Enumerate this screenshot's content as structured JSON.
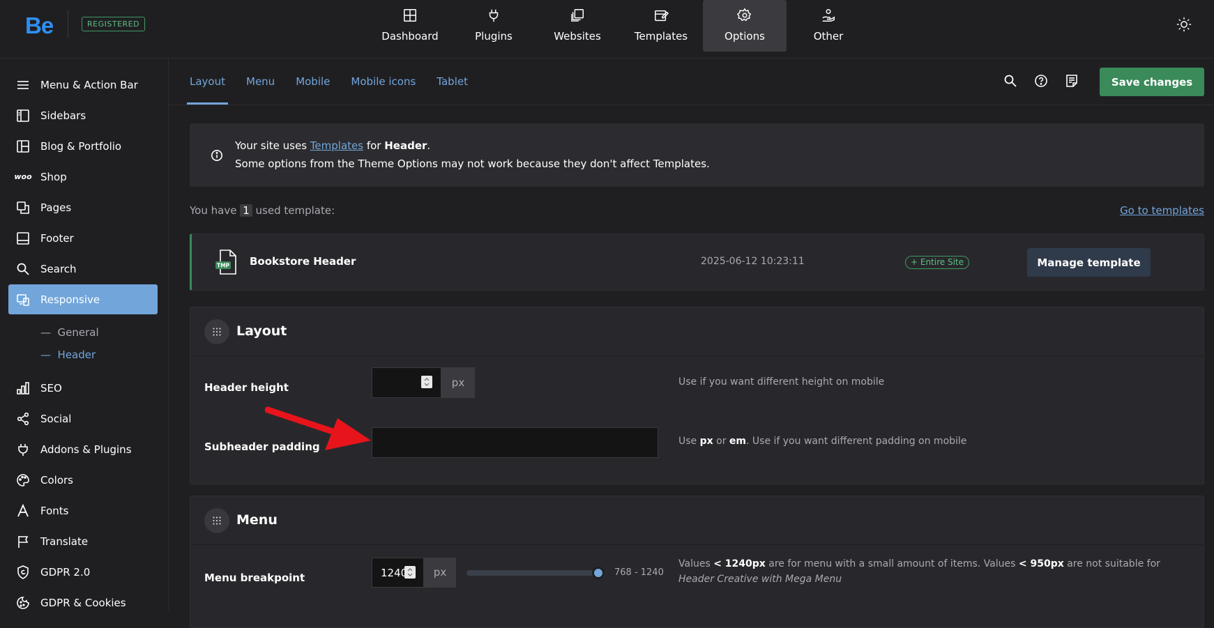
{
  "topbar": {
    "logo": "Be",
    "badge": "REGISTERED",
    "nav": [
      {
        "label": "Dashboard",
        "icon": "dashboard-icon",
        "active": false
      },
      {
        "label": "Plugins",
        "icon": "plug-icon",
        "active": false
      },
      {
        "label": "Websites",
        "icon": "websites-icon",
        "active": false
      },
      {
        "label": "Templates",
        "icon": "templates-icon",
        "active": false
      },
      {
        "label": "Options",
        "icon": "gear-icon",
        "active": true
      },
      {
        "label": "Other",
        "icon": "hand-icon",
        "active": false
      }
    ],
    "theme_toggle_icon": "sun-icon"
  },
  "sidebar": {
    "items": [
      {
        "label": "Menu & Action Bar",
        "icon": "menu-icon"
      },
      {
        "label": "Sidebars",
        "icon": "sidebar-icon"
      },
      {
        "label": "Blog & Portfolio",
        "icon": "layout-icon"
      },
      {
        "label": "Shop",
        "icon": "woo-icon"
      },
      {
        "label": "Pages",
        "icon": "pages-icon"
      },
      {
        "label": "Footer",
        "icon": "footer-icon"
      },
      {
        "label": "Search",
        "icon": "search-icon"
      },
      {
        "label": "Responsive",
        "icon": "responsive-icon",
        "active": true
      },
      {
        "label": "SEO",
        "icon": "chart-icon"
      },
      {
        "label": "Social",
        "icon": "share-icon"
      },
      {
        "label": "Addons & Plugins",
        "icon": "plug-icon"
      },
      {
        "label": "Colors",
        "icon": "palette-icon"
      },
      {
        "label": "Fonts",
        "icon": "font-icon"
      },
      {
        "label": "Translate",
        "icon": "flag-icon"
      },
      {
        "label": "GDPR 2.0",
        "icon": "shield-icon"
      },
      {
        "label": "GDPR & Cookies",
        "icon": "cookie-icon"
      }
    ],
    "woo_text": "woo",
    "subitems": [
      {
        "label": "General",
        "active": false
      },
      {
        "label": "Header",
        "active": true
      }
    ],
    "sub_dash": "—"
  },
  "tabs": [
    {
      "label": "Layout",
      "active": true
    },
    {
      "label": "Menu",
      "active": false
    },
    {
      "label": "Mobile",
      "active": false
    },
    {
      "label": "Mobile icons",
      "active": false
    },
    {
      "label": "Tablet",
      "active": false
    }
  ],
  "toolbar": {
    "save_label": "Save changes"
  },
  "notice": {
    "l1_pre": "Your site uses ",
    "l1_link": "Templates",
    "l1_mid": " for ",
    "l1_bold": "Header",
    "l1_end": ".",
    "l2": "Some options from the Theme Options may not work because they don't affect Templates."
  },
  "used": {
    "pre": "You have ",
    "count": "1",
    "post": " used template:",
    "goto": "Go to templates"
  },
  "template": {
    "icon_label": "TMP",
    "name": "Bookstore Header",
    "date": "2025-06-12 10:23:11",
    "badge": "+ Entire Site",
    "button": "Manage template"
  },
  "layout_section": {
    "title": "Layout",
    "header_height": {
      "label": "Header height",
      "value": "",
      "unit": "px",
      "help": "Use if you want different height on mobile"
    },
    "subheader_padding": {
      "label": "Subheader padding",
      "value": "",
      "help_pre": "Use ",
      "help_b1": "px",
      "help_mid": " or ",
      "help_b2": "em",
      "help_post": ". Use if you want different padding on mobile"
    }
  },
  "menu_section": {
    "title": "Menu",
    "breakpoint": {
      "label": "Menu breakpoint",
      "value": "1240",
      "unit": "px",
      "slider_fill": 1.0,
      "range": "768 - 1240",
      "help_p1": "Values ",
      "help_b1": "< 1240px",
      "help_p2": " are for menu with a small amount of items. Values ",
      "help_b2": "< 950px",
      "help_p3": " are not suitable for ",
      "help_i": "Header Creative with Mega Menu"
    }
  },
  "colors": {
    "accent": "#72a6db",
    "save": "#3a8a5a",
    "badge_green": "#5fbf83",
    "arrow": "#e8141b"
  }
}
